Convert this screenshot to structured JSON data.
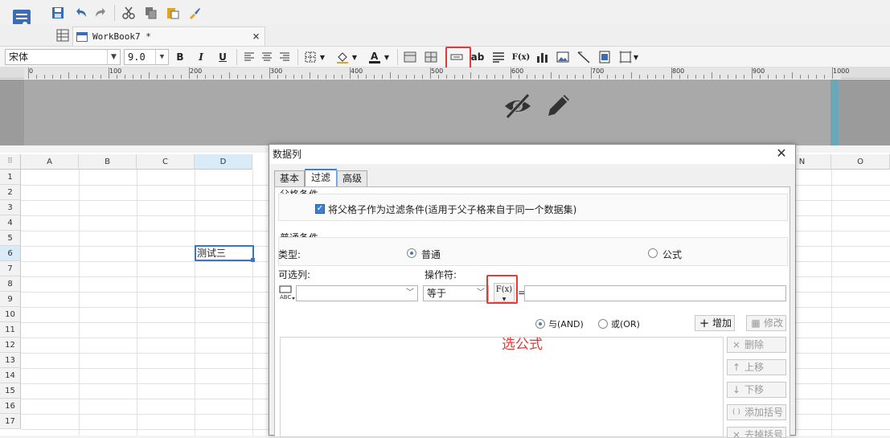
{
  "file_tab": {
    "title": "WorkBook7 *",
    "close": "×"
  },
  "format_bar": {
    "font_name": "宋体",
    "font_size": "9.0",
    "bold": "B",
    "italic": "I",
    "underline": "U",
    "text_tool": "ab",
    "formula_tool": "F(x)"
  },
  "ruler": {
    "ticks": [
      "0",
      "100",
      "200",
      "300",
      "400",
      "500",
      "600",
      "700",
      "800",
      "900",
      "1000"
    ]
  },
  "grid": {
    "columns": [
      "A",
      "B",
      "C",
      "D",
      "N",
      "O"
    ],
    "rows": [
      "1",
      "2",
      "3",
      "4",
      "5",
      "6",
      "7",
      "8",
      "9",
      "10",
      "11",
      "12",
      "13",
      "14",
      "15",
      "16",
      "17"
    ],
    "cell_d6": "测试三"
  },
  "dialog": {
    "title": "数据列",
    "tabs": [
      {
        "label": "基本"
      },
      {
        "label": "过滤"
      },
      {
        "label": "高级"
      }
    ],
    "parent_section": {
      "title": "父格条件",
      "checkbox_label": "将父格子作为过滤条件(适用于父子格来自于同一个数据集)",
      "checked": true
    },
    "normal_section": {
      "title": "普通条件",
      "type_label": "类型:",
      "radio_normal": "普通",
      "radio_formula": "公式",
      "selected": "普通"
    },
    "optional_column_label": "可选列:",
    "operator_label": "操作符:",
    "operator_value": "等于",
    "formula_button": "F(x)",
    "equals_sign": "=",
    "and_label": "与(AND)",
    "or_label": "或(OR)",
    "logic_selected": "与(AND)",
    "add_button": "增加",
    "modify_button": "修改",
    "side_buttons": [
      {
        "label": "删除",
        "icon": "×"
      },
      {
        "label": "上移",
        "icon": "↑"
      },
      {
        "label": "下移",
        "icon": "↓"
      },
      {
        "label": "添加括号",
        "icon": "( )"
      },
      {
        "label": "去掉括号",
        "icon": "×"
      }
    ]
  },
  "annotation": {
    "text": "选公式",
    "color": "#e53935"
  }
}
